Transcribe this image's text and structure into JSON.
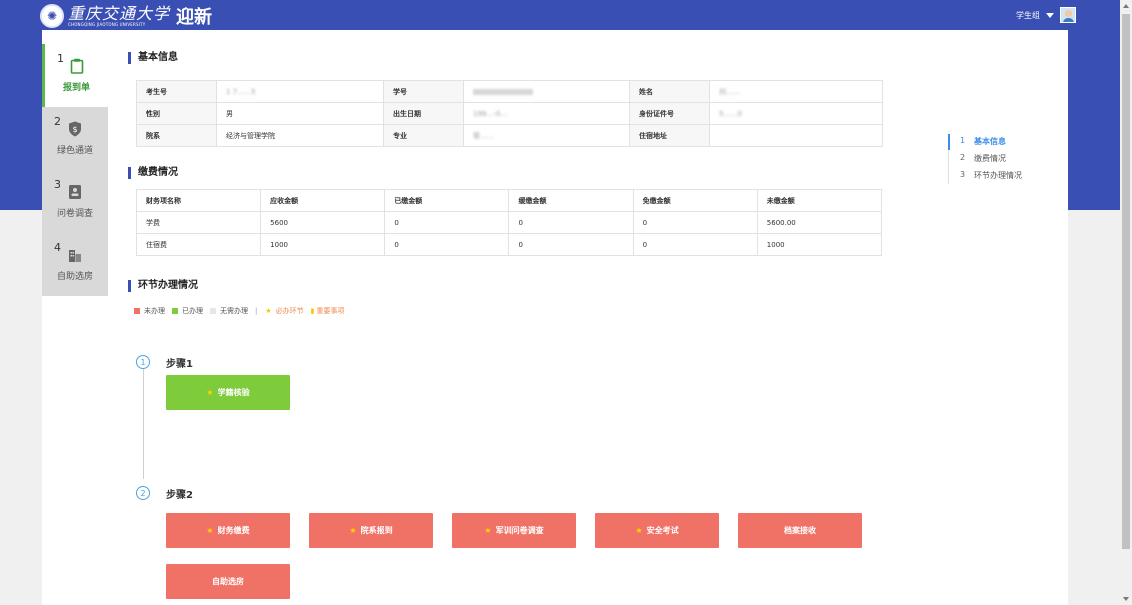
{
  "header": {
    "logo_cn": "重庆交通大学",
    "logo_en": "CHONGQING JIAOTONG UNIVERSITY",
    "app_name": "迎新",
    "role": "学生组"
  },
  "sidebar": {
    "items": [
      {
        "num": "1",
        "label": "报到单",
        "icon": "clipboard-icon"
      },
      {
        "num": "2",
        "label": "绿色通道",
        "icon": "money-shield-icon"
      },
      {
        "num": "3",
        "label": "问卷调查",
        "icon": "survey-icon"
      },
      {
        "num": "4",
        "label": "自助选房",
        "icon": "building-icon"
      }
    ]
  },
  "basic_info": {
    "title": "基本信息",
    "rows": [
      [
        {
          "label": "考生号",
          "value": "1 7……5"
        },
        {
          "label": "学号",
          "value": ""
        },
        {
          "label": "姓名",
          "value": "刘……"
        }
      ],
      [
        {
          "label": "性别",
          "value": "男"
        },
        {
          "label": "出生日期",
          "value": "199…-0…"
        },
        {
          "label": "身份证件号",
          "value": "5……0"
        }
      ],
      [
        {
          "label": "院系",
          "value": "经济与管理学院"
        },
        {
          "label": "专业",
          "value": "管……"
        },
        {
          "label": "住宿地址",
          "value": ""
        }
      ]
    ]
  },
  "fees": {
    "title": "缴费情况",
    "headers": [
      "财务项名称",
      "应收金额",
      "已缴金额",
      "缓缴金额",
      "免缴金额",
      "未缴金额"
    ],
    "rows": [
      [
        "学费",
        "5600",
        "0",
        "0",
        "0",
        "5600.00"
      ],
      [
        "住宿费",
        "1000",
        "0",
        "0",
        "0",
        "1000"
      ]
    ]
  },
  "process": {
    "title": "环节办理情况",
    "legend": {
      "not_done": "未办理",
      "done": "已办理",
      "no_need": "无需办理",
      "separator": "|",
      "required": "必办环节",
      "important": "重要事项"
    },
    "steps": [
      {
        "num": "1",
        "label": "步骤1",
        "buttons": [
          {
            "label": "学籍核验",
            "required": true,
            "state": "done"
          }
        ]
      },
      {
        "num": "2",
        "label": "步骤2",
        "buttons": [
          {
            "label": "财务缴费",
            "required": true,
            "state": "not_done"
          },
          {
            "label": "院系报到",
            "required": true,
            "state": "not_done"
          },
          {
            "label": "军训问卷调查",
            "required": true,
            "state": "not_done"
          },
          {
            "label": "安全考试",
            "required": true,
            "state": "not_done"
          },
          {
            "label": "档案接收",
            "required": false,
            "state": "not_done"
          },
          {
            "label": "自助选房",
            "required": false,
            "state": "not_done"
          }
        ]
      }
    ]
  },
  "anchor_nav": {
    "items": [
      {
        "num": "1",
        "label": "基本信息",
        "active": true
      },
      {
        "num": "2",
        "label": "缴费情况",
        "active": false
      },
      {
        "num": "3",
        "label": "环节办理情况",
        "active": false
      }
    ]
  },
  "colors": {
    "primary": "#3a4fb4",
    "done": "#7ecb3b",
    "not_done": "#f07267",
    "no_need": "#e6e6e6",
    "required_star": "#f6c800",
    "anchor_active": "#3a8ee6"
  }
}
